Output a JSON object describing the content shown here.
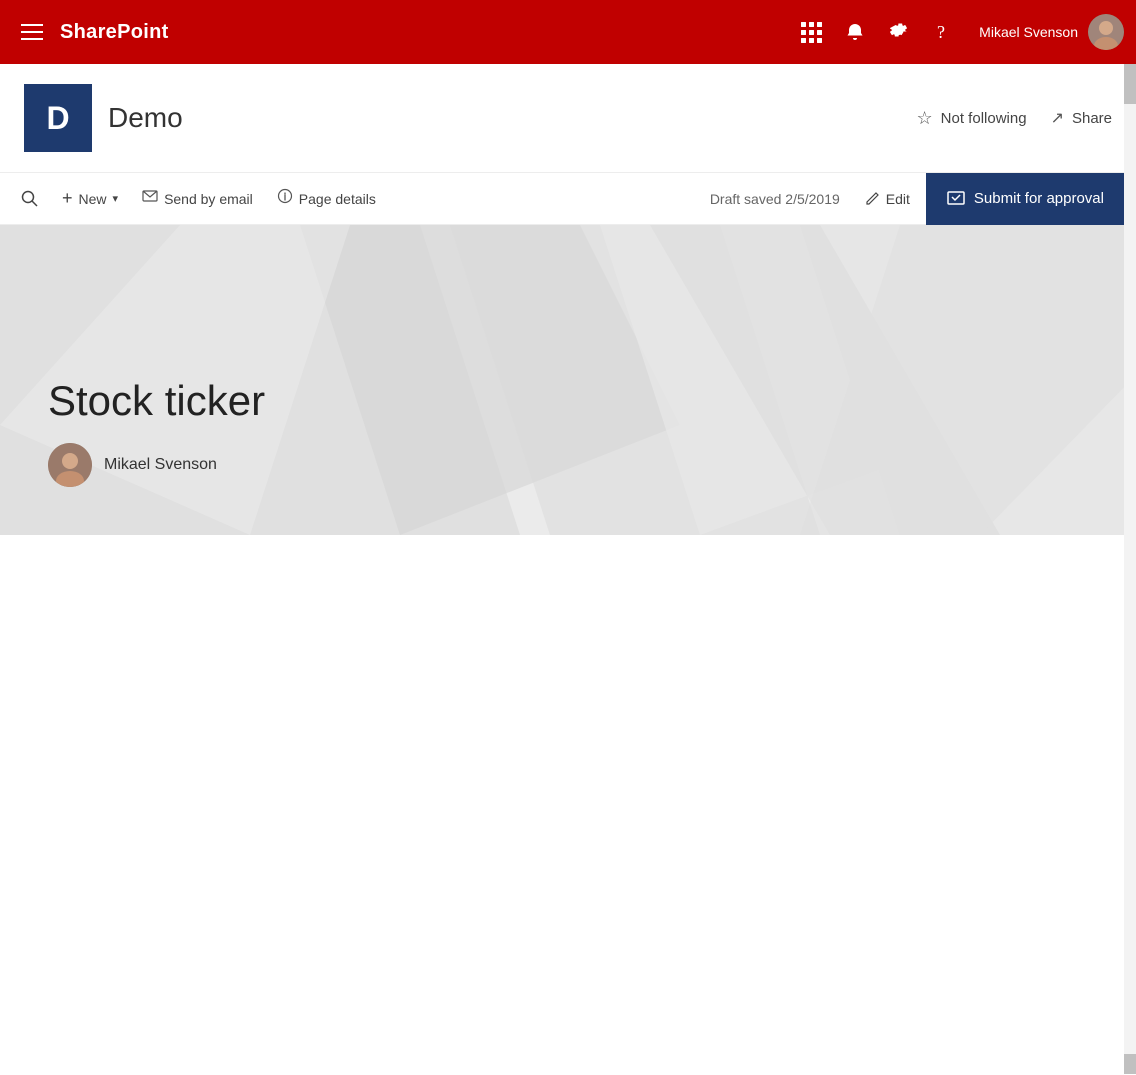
{
  "nav": {
    "brand": "SharePoint",
    "user_name": "Mikael Svenson",
    "icons": [
      "waffle",
      "bell",
      "gear",
      "help"
    ]
  },
  "site_header": {
    "logo_letter": "D",
    "site_name": "Demo",
    "not_following_label": "Not following",
    "share_label": "Share"
  },
  "toolbar": {
    "new_label": "New",
    "send_by_email_label": "Send by email",
    "page_details_label": "Page details",
    "draft_status": "Draft saved 2/5/2019",
    "edit_label": "Edit",
    "submit_label": "Submit for approval"
  },
  "hero": {
    "title": "Stock ticker",
    "author_name": "Mikael Svenson"
  }
}
